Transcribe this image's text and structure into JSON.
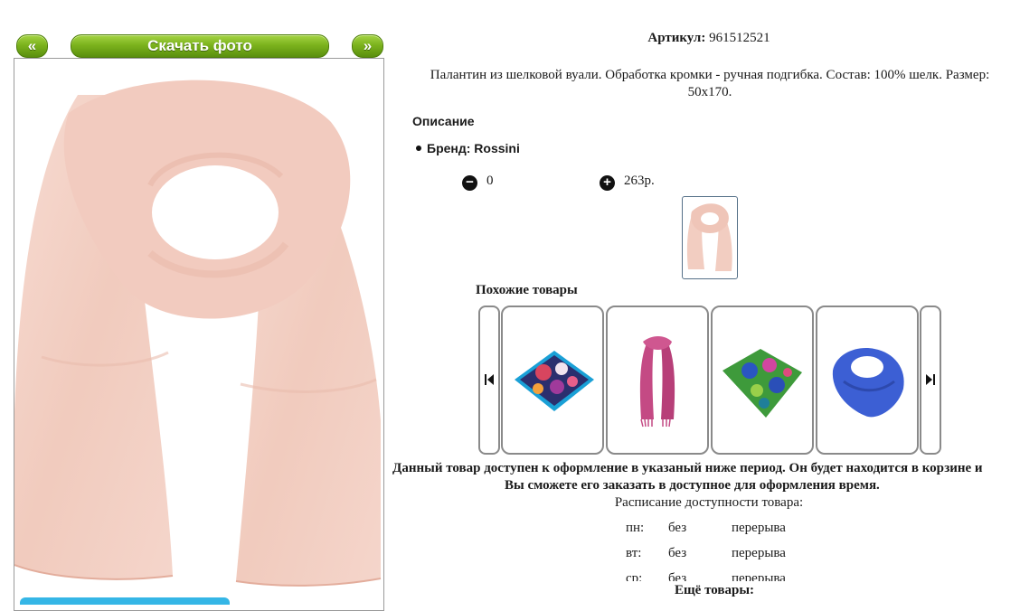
{
  "gallery": {
    "prev_label": "«",
    "download_label": "Скачать фото",
    "next_label": "»"
  },
  "product": {
    "sku_label": "Артикул:",
    "sku_value": "961512521",
    "description": "Палантин из шелковой вуали. Обработка кромки - ручная подгибка. Состав: 100% шелк. Размер: 50х170.",
    "section_title": "Описание",
    "brand": "Бренд: Rossini",
    "quantity": "0",
    "price": "263р."
  },
  "similar": {
    "title": "Похожие товары",
    "items": [
      {
        "name": "floral-silk-scarf-blue-border"
      },
      {
        "name": "pink-scarf-fringe"
      },
      {
        "name": "green-floral-scarf"
      },
      {
        "name": "blue-knit-shawl"
      }
    ]
  },
  "availability": {
    "line1": "Данный товар доступен к оформление в указаный ниже период. Он будет находится в корзине и",
    "line2": "Вы сможете его заказать в доступное для оформления время.",
    "schedule_title": "Расписание доступности товара:",
    "schedule": [
      {
        "day": "пн:",
        "b": "без",
        "p": "перерыва"
      },
      {
        "day": "вт:",
        "b": "без",
        "p": "перерыва"
      },
      {
        "day": "ср:",
        "b": "без",
        "p": "перерыва"
      }
    ]
  },
  "more_label": "Ещё товары:",
  "colors": {
    "button_green": "#7cb31d",
    "scarf_pink": "#f3cfc3",
    "border": "#8a8a8a"
  }
}
